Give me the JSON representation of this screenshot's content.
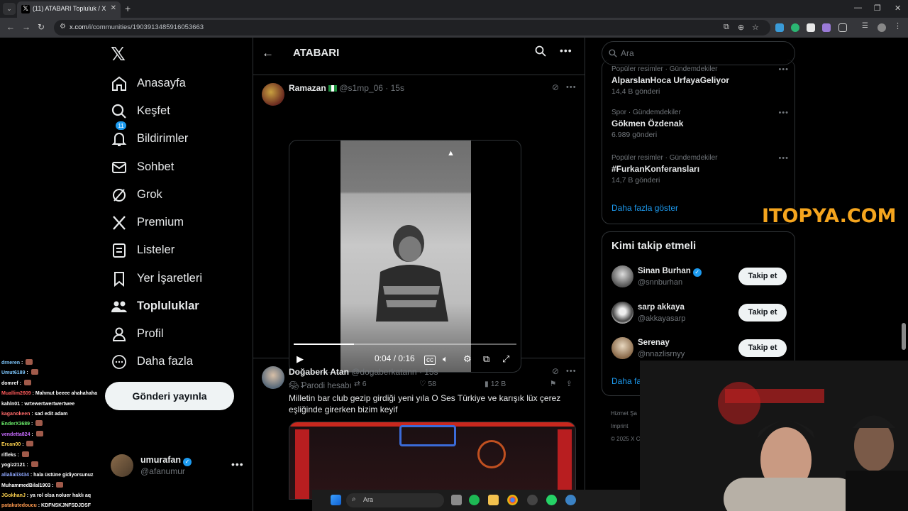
{
  "browser": {
    "tab_count_label": "⌄",
    "tab_title": "(11) ATABARI Topluluk / X",
    "tab_close": "✕",
    "new_tab": "+",
    "url_host": "x.com",
    "url_path": "/i/communities/1903913485916053663",
    "win_min": "—",
    "win_max": "❐",
    "win_close": "✕"
  },
  "nav": {
    "items": [
      {
        "label": "Anasayfa",
        "icon": "home-icon"
      },
      {
        "label": "Keşfet",
        "icon": "search-icon"
      },
      {
        "label": "Bildirimler",
        "icon": "bell-icon",
        "badge": "11"
      },
      {
        "label": "Sohbet",
        "icon": "mail-icon"
      },
      {
        "label": "Grok",
        "icon": "grok-icon"
      },
      {
        "label": "Premium",
        "icon": "x-icon"
      },
      {
        "label": "Listeler",
        "icon": "list-icon"
      },
      {
        "label": "Yer İşaretleri",
        "icon": "bookmark-icon"
      },
      {
        "label": "Topluluklar",
        "icon": "communities-icon"
      },
      {
        "label": "Profil",
        "icon": "user-icon"
      },
      {
        "label": "Daha fazla",
        "icon": "more-circle-icon"
      }
    ],
    "post_button": "Gönderi yayınla",
    "profile": {
      "name": "umurafan",
      "handle": "@afanumur"
    }
  },
  "community": {
    "title": "ATABARI"
  },
  "tweets": [
    {
      "name": "Ramazan",
      "handle": "@s1mp_06",
      "time": "15s",
      "video_time": "0:04 / 0:16",
      "progress": 0.27,
      "stats": {
        "replies": "1",
        "retweets": "6",
        "likes": "58",
        "views": "12 B"
      }
    },
    {
      "name": "Doğaberk Atan",
      "handle": "@dogaberkatann",
      "time": "15s",
      "parody": "Parodi hesabı",
      "text": "Milletin bar club gezip girdiği yeni yıla O Ses Türkiye ve karışık lüx çerez eşliğinde girerken bizim keyif"
    }
  ],
  "right": {
    "search_placeholder": "Ara",
    "trends": [
      {
        "category": "Popüler resimler · Gündemdekiler",
        "name": "AlparslanHoca UrfayaGeliyor",
        "count": "14,4 B gönderi"
      },
      {
        "category": "Spor · Gündemdekiler",
        "name": "Gökmen Özdenak",
        "count": "6.989 gönderi"
      },
      {
        "category": "Popüler resimler · Gündemdekiler",
        "name": "#FurkanKonferansları",
        "count": "14,7 B gönderi"
      }
    ],
    "show_more": "Daha fazla göster",
    "who_to_follow_title": "Kimi takip etmeli",
    "suggestions": [
      {
        "name": "Sinan Burhan",
        "handle": "@snnburhan",
        "verified": true,
        "button": "Takip et"
      },
      {
        "name": "sarp akkaya",
        "handle": "@akkayasarp",
        "verified": false,
        "button": "Takip et"
      },
      {
        "name": "Serenay",
        "handle": "@nnazlisrnyy",
        "verified": false,
        "button": "Takip et"
      }
    ],
    "follow_more": "Daha fa",
    "footer": [
      "Hizmet Şa",
      "Imprint",
      "© 2025 X C"
    ]
  },
  "overlay": {
    "watermark": "ITOPYA.COM",
    "chat": [
      {
        "user": "drneren",
        "msg": "",
        "color": "#7ec8ff"
      },
      {
        "user": "Umut6189",
        "msg": "",
        "color": "#7ec8ff"
      },
      {
        "user": "domref",
        "msg": "",
        "color": "#ffffff"
      },
      {
        "user": "Muallim2609",
        "msg": "Mahmut beeee ahahahaha",
        "color": "#ff5a5a"
      },
      {
        "user": "kahln01",
        "msg": "wrtewertwertwertwee",
        "color": "#ffffff"
      },
      {
        "user": "kaganokeen",
        "msg": "sad edit adam",
        "color": "#ff6a6a"
      },
      {
        "user": "EnderX3689",
        "msg": "",
        "color": "#6cf06c"
      },
      {
        "user": "vendetta824",
        "msg": "",
        "color": "#c86cff"
      },
      {
        "user": "Ercan00",
        "msg": "",
        "color": "#ffd34f"
      },
      {
        "user": "rifleks",
        "msg": "",
        "color": "#ffffff"
      },
      {
        "user": "yogiz2121",
        "msg": "",
        "color": "#ffffff"
      },
      {
        "user": "alialiali3434",
        "msg": "hala üstüne gidiyorsunuz",
        "color": "#8fa8ff"
      },
      {
        "user": "MuhammedBilal1903",
        "msg": "",
        "color": "#ffffff"
      },
      {
        "user": "JGokhanJ",
        "msg": "ya rol olsa noluer haklı aq",
        "color": "#ffd34f"
      },
      {
        "user": "patakutedoucu",
        "msg": "KDFNSKJNFSDJDSF",
        "color": "#ff9a4f"
      }
    ],
    "taskbar_search": "Ara"
  }
}
